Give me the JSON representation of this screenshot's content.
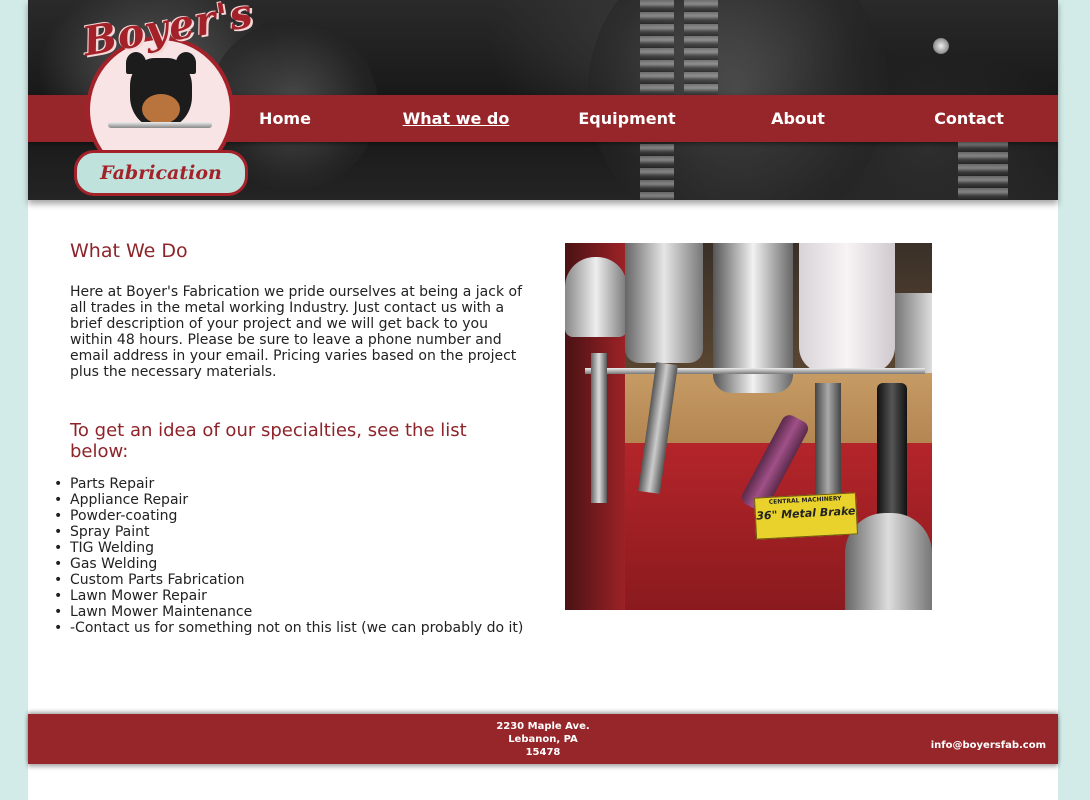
{
  "nav": {
    "items": [
      {
        "label": "Home",
        "active": false
      },
      {
        "label": "What we do",
        "active": true
      },
      {
        "label": "Equipment",
        "active": false
      },
      {
        "label": "About",
        "active": false
      },
      {
        "label": "Contact",
        "active": false
      }
    ]
  },
  "logo": {
    "script_text": "Boyer's",
    "ribbon_text": "Fabrication"
  },
  "main": {
    "heading": "What We Do",
    "intro": "Here at Boyer's Fabrication we pride ourselves at being a jack of all trades in the metal working Industry. Just contact us with a brief description of your project and we will get back to you within 48 hours. Please be sure to leave a phone number and email address in your email. Pricing varies based on the project plus the necessary materials.",
    "subheading": "To get an idea of our specialties, see the list below:",
    "specialties": [
      "Parts Repair",
      "Appliance Repair",
      "Powder-coating",
      "Spray Paint",
      "TIG Welding",
      "Gas Welding",
      "Custom Parts Fabrication",
      "Lawn Mower Repair",
      "Lawn Mower Maintenance",
      "-Contact us for something not on this list (we can probably do it)"
    ]
  },
  "photo": {
    "label_line1": "CENTRAL MACHINERY",
    "label_line2": "36\" Metal Brake"
  },
  "footer": {
    "address_line1": "2230 Maple Ave.",
    "address_line2": "Lebanon, PA",
    "address_line3": "15478",
    "email": "info@boyersfab.com"
  },
  "colors": {
    "brand_red": "#97262a",
    "heading_red": "#8e2329",
    "background": "#d3ebe8"
  }
}
